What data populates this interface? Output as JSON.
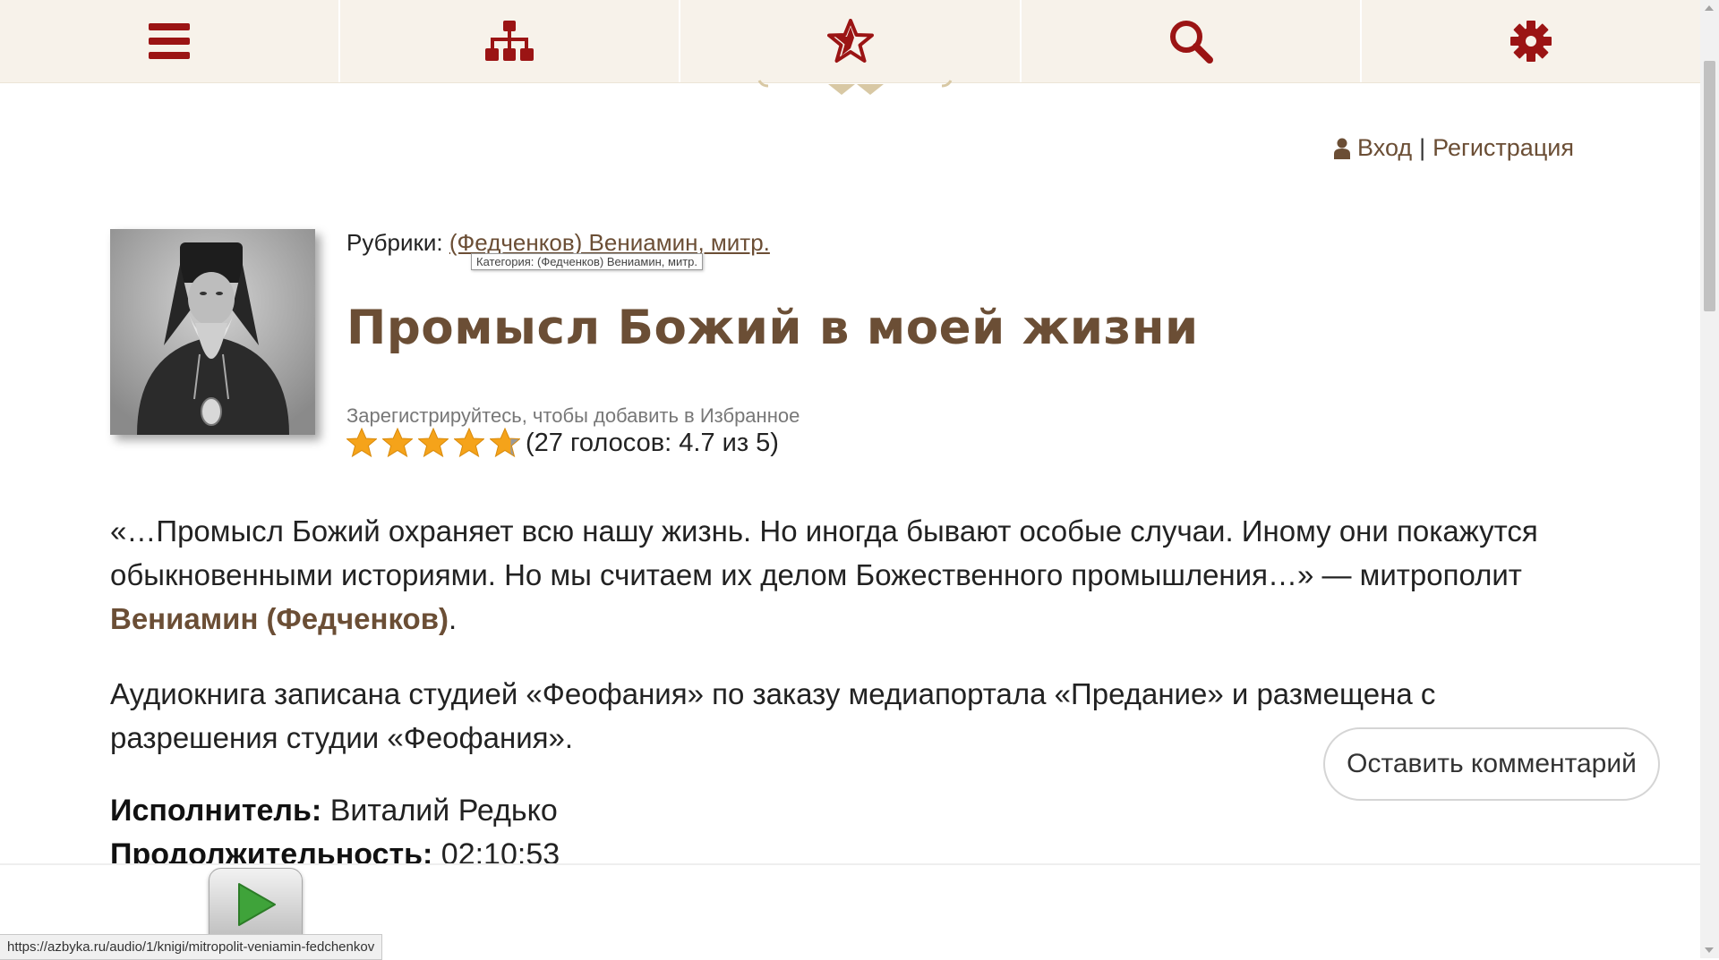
{
  "nav": {
    "items": [
      {
        "name": "menu",
        "icon": "hamburger-icon"
      },
      {
        "name": "sitemap",
        "icon": "sitemap-icon"
      },
      {
        "name": "favorites",
        "icon": "star-icon"
      },
      {
        "name": "search",
        "icon": "search-icon"
      },
      {
        "name": "settings",
        "icon": "gear-icon"
      }
    ],
    "icon_color": "#9b1414"
  },
  "auth": {
    "login": "Вход",
    "separator": "|",
    "register": "Регистрация",
    "icon": "user-icon"
  },
  "article": {
    "rubric_label": "Рубрики:",
    "rubric_link": "(Федченков) Вениамин, митр.",
    "tooltip": "Категория: (Федченков) Вениамин, митр.",
    "title": "Промысл Божий в моей жизни",
    "favorite_hint": "Зарегистрируйтесь, чтобы добавить в Избранное",
    "rating": {
      "stars_total": 5,
      "stars_value": 4.7,
      "votes_text": "(27 голосов: 4.7 из 5)"
    },
    "quote_text": "«…Промысл Божий охраняет всю нашу жизнь. Но иногда бывают особые случаи. Иному они покажутся обыкновенными историями. Но мы считаем их делом Божественного промышления…» — митрополит ",
    "quote_author": "Вениамин (Федченков)",
    "quote_end": ".",
    "studio_note": "Аудиокнига записана студией «Феофания» по заказу медиапортала «Предание» и размещена с разрешения студии «Феофания».",
    "performer_label": "Исполнитель:",
    "performer": "Виталий Редько",
    "duration_label": "Продолжительность:",
    "duration": "02:10:53"
  },
  "comment_button": "Оставить комментарий",
  "status_url": "https://azbyka.ru/audio/1/knigi/mitropolit-veniamin-fedchenkov",
  "colors": {
    "brand_brown": "#6b4e35",
    "nav_bg": "#f7f2ea",
    "star_gold": "#f5a31a"
  }
}
